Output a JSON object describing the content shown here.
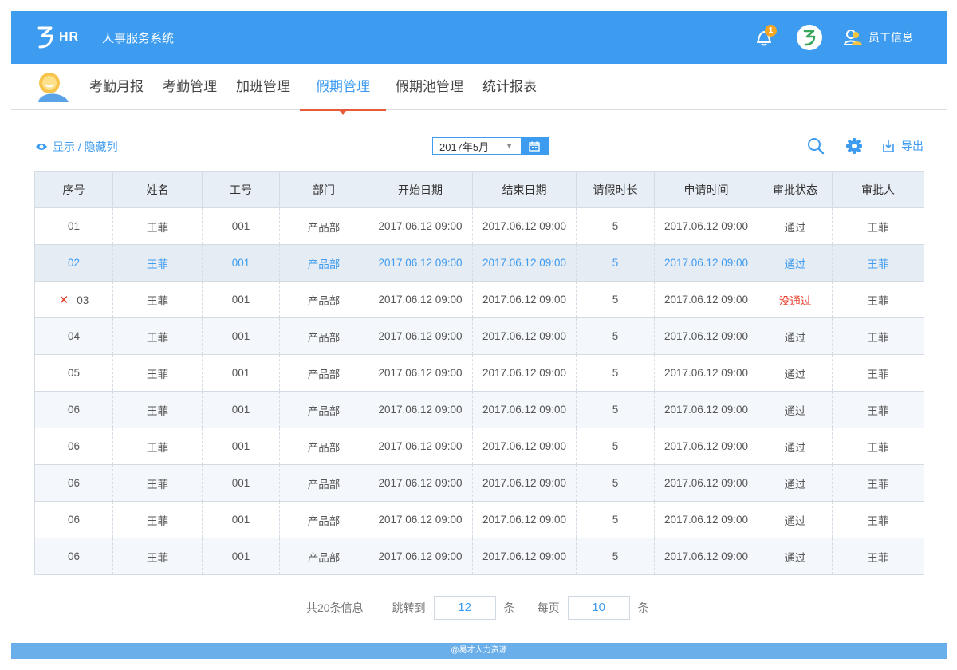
{
  "header": {
    "brand_text": "HR",
    "system_title": "人事服务系统",
    "notification_count": "1",
    "employee_info_label": "员工信息",
    "accent_color": "#3d9bf0"
  },
  "nav": {
    "tabs": [
      {
        "label": "考勤月报",
        "active": false
      },
      {
        "label": "考勤管理",
        "active": false
      },
      {
        "label": "加班管理",
        "active": false
      },
      {
        "label": "假期管理",
        "active": true
      },
      {
        "label": "假期池管理",
        "active": false
      },
      {
        "label": "统计报表",
        "active": false
      }
    ]
  },
  "toolbar": {
    "toggle_columns_label": "显示 / 隐藏列",
    "month_value": "2017年5月",
    "export_label": "导出"
  },
  "table": {
    "columns": [
      "序号",
      "姓名",
      "工号",
      "部门",
      "开始日期",
      "结束日期",
      "请假时长",
      "申请时间",
      "审批状态",
      "审批人"
    ],
    "rows": [
      {
        "seq": "01",
        "name": "王菲",
        "id": "001",
        "dept": "产品部",
        "start": "2017.06.12  09:00",
        "end": "2017.06.12  09:00",
        "duration": "5",
        "applied": "2017.06.12  09:00",
        "status": "通过",
        "approver": "王菲",
        "selected": false,
        "marked": false,
        "failed": false
      },
      {
        "seq": "02",
        "name": "王菲",
        "id": "001",
        "dept": "产品部",
        "start": "2017.06.12  09:00",
        "end": "2017.06.12  09:00",
        "duration": "5",
        "applied": "2017.06.12  09:00",
        "status": "通过",
        "approver": "王菲",
        "selected": true,
        "marked": false,
        "failed": false
      },
      {
        "seq": "03",
        "name": "王菲",
        "id": "001",
        "dept": "产品部",
        "start": "2017.06.12  09:00",
        "end": "2017.06.12  09:00",
        "duration": "5",
        "applied": "2017.06.12  09:00",
        "status": "没通过",
        "approver": "王菲",
        "selected": false,
        "marked": true,
        "failed": true
      },
      {
        "seq": "04",
        "name": "王菲",
        "id": "001",
        "dept": "产品部",
        "start": "2017.06.12  09:00",
        "end": "2017.06.12  09:00",
        "duration": "5",
        "applied": "2017.06.12  09:00",
        "status": "通过",
        "approver": "王菲",
        "selected": false,
        "marked": false,
        "failed": false
      },
      {
        "seq": "05",
        "name": "王菲",
        "id": "001",
        "dept": "产品部",
        "start": "2017.06.12  09:00",
        "end": "2017.06.12  09:00",
        "duration": "5",
        "applied": "2017.06.12  09:00",
        "status": "通过",
        "approver": "王菲",
        "selected": false,
        "marked": false,
        "failed": false
      },
      {
        "seq": "06",
        "name": "王菲",
        "id": "001",
        "dept": "产品部",
        "start": "2017.06.12  09:00",
        "end": "2017.06.12  09:00",
        "duration": "5",
        "applied": "2017.06.12  09:00",
        "status": "通过",
        "approver": "王菲",
        "selected": false,
        "marked": false,
        "failed": false
      },
      {
        "seq": "06",
        "name": "王菲",
        "id": "001",
        "dept": "产品部",
        "start": "2017.06.12  09:00",
        "end": "2017.06.12  09:00",
        "duration": "5",
        "applied": "2017.06.12  09:00",
        "status": "通过",
        "approver": "王菲",
        "selected": false,
        "marked": false,
        "failed": false
      },
      {
        "seq": "06",
        "name": "王菲",
        "id": "001",
        "dept": "产品部",
        "start": "2017.06.12  09:00",
        "end": "2017.06.12  09:00",
        "duration": "5",
        "applied": "2017.06.12  09:00",
        "status": "通过",
        "approver": "王菲",
        "selected": false,
        "marked": false,
        "failed": false
      },
      {
        "seq": "06",
        "name": "王菲",
        "id": "001",
        "dept": "产品部",
        "start": "2017.06.12  09:00",
        "end": "2017.06.12  09:00",
        "duration": "5",
        "applied": "2017.06.12  09:00",
        "status": "通过",
        "approver": "王菲",
        "selected": false,
        "marked": false,
        "failed": false
      },
      {
        "seq": "06",
        "name": "王菲",
        "id": "001",
        "dept": "产品部",
        "start": "2017.06.12  09:00",
        "end": "2017.06.12  09:00",
        "duration": "5",
        "applied": "2017.06.12  09:00",
        "status": "通过",
        "approver": "王菲",
        "selected": false,
        "marked": false,
        "failed": false
      }
    ]
  },
  "pager": {
    "total_label": "共20条信息",
    "jump_label": "跳转到",
    "jump_value": "12",
    "unit_label": "条",
    "per_page_label": "每页",
    "per_page_value": "10"
  },
  "footer": {
    "text": "@易才人力资源"
  }
}
